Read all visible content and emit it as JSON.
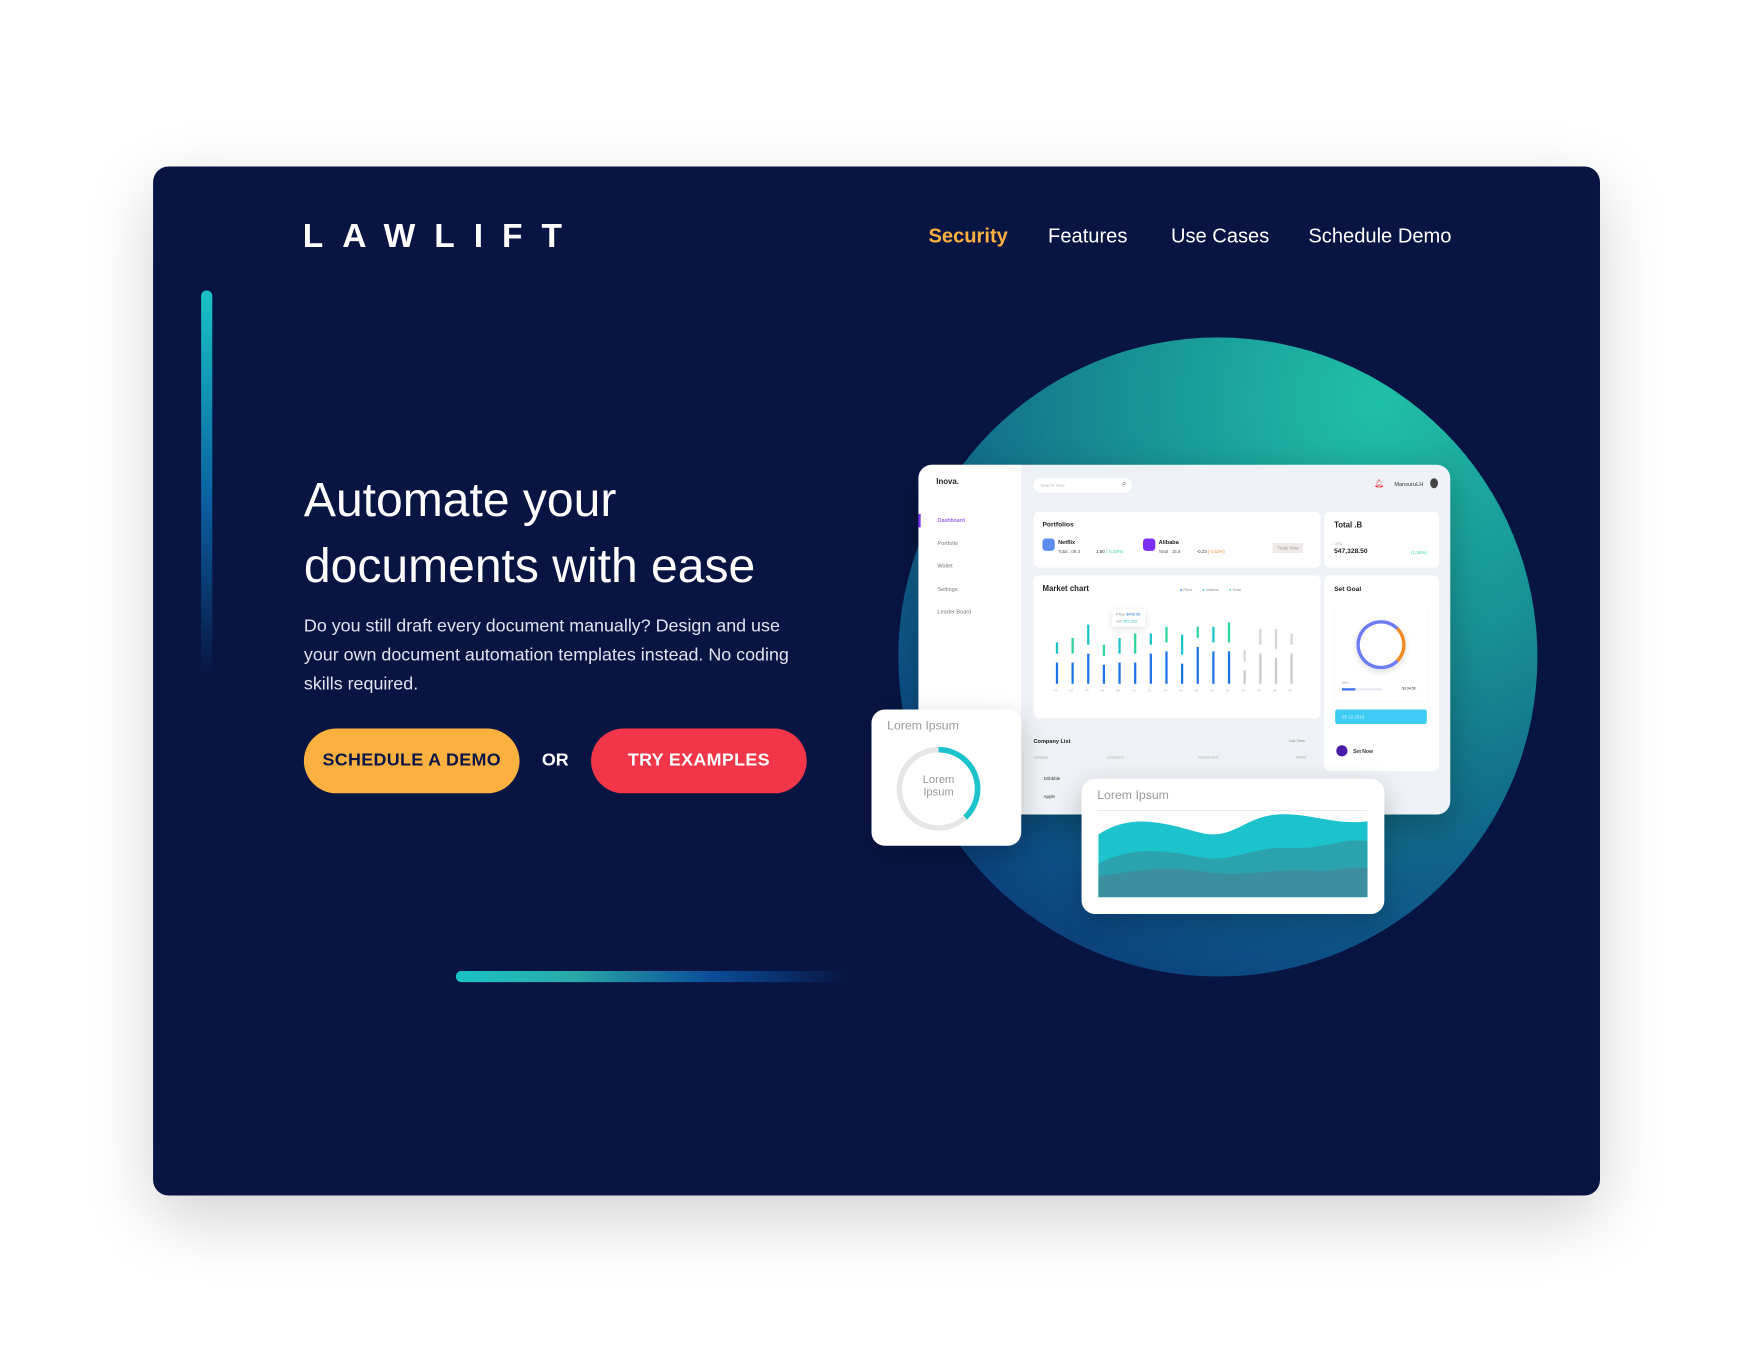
{
  "brand": {
    "logo": "LAWLIFT"
  },
  "nav": {
    "items": [
      {
        "label": "Security",
        "active": true
      },
      {
        "label": "Features"
      },
      {
        "label": "Use Cases"
      },
      {
        "label": "Schedule Demo"
      }
    ],
    "active_color": "#fbb040"
  },
  "hero": {
    "title_line1": "Automate your",
    "title_line2": "documents with ease",
    "description": "Do you still draft every document manually? Design and use your own document automation templates instead. No coding skills required.",
    "cta_primary": "SCHEDULE A DEMO",
    "or": "OR",
    "cta_secondary": "TRY EXAMPLES"
  },
  "colors": {
    "background": "#081542",
    "primary_button": "#fbb040",
    "secondary_button": "#f2364a",
    "accent": "#19c3c6"
  },
  "dashboard": {
    "brand": "Inova.",
    "sidebar": [
      "Dashboard",
      "Portfolio",
      "Wallet",
      "Settings",
      "Leader Board"
    ],
    "search_placeholder": "Search Now",
    "user": "MansuruLH",
    "portfolios": {
      "title": "Portfolios",
      "items": [
        {
          "name": "Netflix",
          "total": "Total : 09.3",
          "change": "1.50",
          "pct": "( 0.33%)"
        },
        {
          "name": "Alibaba",
          "total": "Total : 15.8",
          "change": "-0.23",
          "pct": "( 0.52%)"
        }
      ],
      "trade": "Trade Now"
    },
    "total": {
      "title": "Total .B",
      "currency": "USD",
      "value": "547,328.50",
      "pct": "(1.34%)"
    },
    "market": {
      "title": "Market chart",
      "legend": [
        "Price",
        "Volume",
        "Goal"
      ],
      "tooltip": {
        "price_label": "Price",
        "price": "$456.95",
        "vol_label": "Vol",
        "vol": "252.263"
      },
      "y_ticks": [
        "95",
        "75",
        "50",
        "25",
        "10",
        "0"
      ],
      "x_ticks": [
        "01",
        "02",
        "04",
        "06",
        "08",
        "10",
        "12",
        "14",
        "16",
        "18",
        "20",
        "22",
        "24",
        "26",
        "28",
        "30"
      ],
      "bars": [
        0.28,
        0.28,
        0.4,
        0.26,
        0.28,
        0.28,
        0.4,
        0.44,
        0.27,
        0.5,
        0.44,
        0.44,
        0.18,
        0.4,
        0.34,
        0.4
      ]
    },
    "goal": {
      "title": "Set Goal",
      "pct": "85%",
      "amount": "$134.50",
      "progress": 0.85,
      "date": "05  12  2019",
      "set_now": "Set Now"
    },
    "company": {
      "title": "Company List",
      "view": "List View",
      "columns": [
        "Company",
        "Investment",
        "Present worth",
        "Market"
      ],
      "rows": [
        "Dribbble",
        "Apple"
      ]
    }
  },
  "cards": {
    "donut_title": "Lorem Ipsum",
    "donut_center": "Lorem Ipsum",
    "donut_fill": 0.38,
    "area_title": "Lorem Ipsum"
  }
}
